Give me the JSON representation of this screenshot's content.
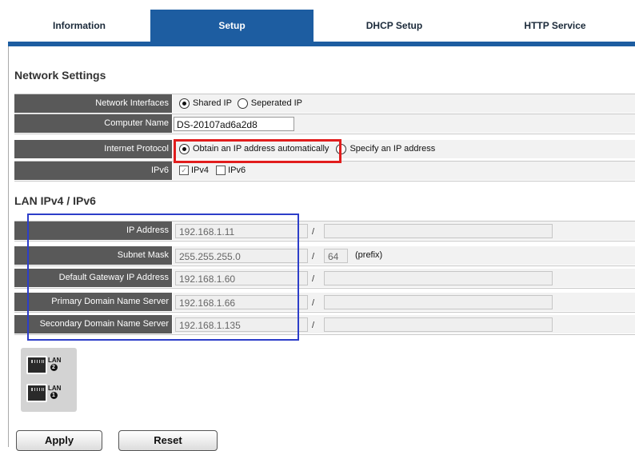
{
  "tabs": [
    {
      "label": "Information",
      "active": false
    },
    {
      "label": "Setup",
      "active": true
    },
    {
      "label": "DHCP Setup",
      "active": false
    },
    {
      "label": "HTTP Service",
      "active": false
    }
  ],
  "network_settings": {
    "title": "Network Settings",
    "network_interfaces": {
      "label": "Network Interfaces",
      "options": [
        "Shared IP",
        "Seperated IP"
      ],
      "selected": "Shared IP"
    },
    "computer_name": {
      "label": "Computer Name",
      "value": "DS-20107ad6a2d8"
    },
    "internet_protocol": {
      "label": "Internet Protocol",
      "options": [
        "Obtain an IP address automatically",
        "Specify an IP address"
      ],
      "selected": "Obtain an IP address automatically"
    },
    "ipv6": {
      "label": "IPv6",
      "ipv4_label": "IPv4",
      "ipv4_checked": true,
      "ipv6_label": "IPv6",
      "ipv6_checked": false
    }
  },
  "lan": {
    "title": "LAN IPv4 / IPv6",
    "slash": "/",
    "rows": [
      {
        "label": "IP Address",
        "ipv4": "192.168.1.11",
        "ipv6": ""
      },
      {
        "label": "Subnet Mask",
        "ipv4": "255.255.255.0",
        "ipv6": "64",
        "suffix": "(prefix)"
      },
      {
        "label": "Default Gateway IP Address",
        "ipv4": "192.168.1.60",
        "ipv6": ""
      },
      {
        "label": "Primary Domain Name Server",
        "ipv4": "192.168.1.66",
        "ipv6": ""
      },
      {
        "label": "Secondary Domain Name Server",
        "ipv4": "192.168.1.135",
        "ipv6": ""
      }
    ]
  },
  "lan_ports": {
    "port2": {
      "label": "LAN",
      "number": "2"
    },
    "port1": {
      "label": "LAN",
      "number": "1"
    }
  },
  "buttons": {
    "apply": "Apply",
    "reset": "Reset"
  },
  "colors": {
    "tab_active": "#1d5da1",
    "label_bg": "#595959",
    "highlight_red": "#e11d1d",
    "highlight_blue": "#2d3ec9"
  }
}
